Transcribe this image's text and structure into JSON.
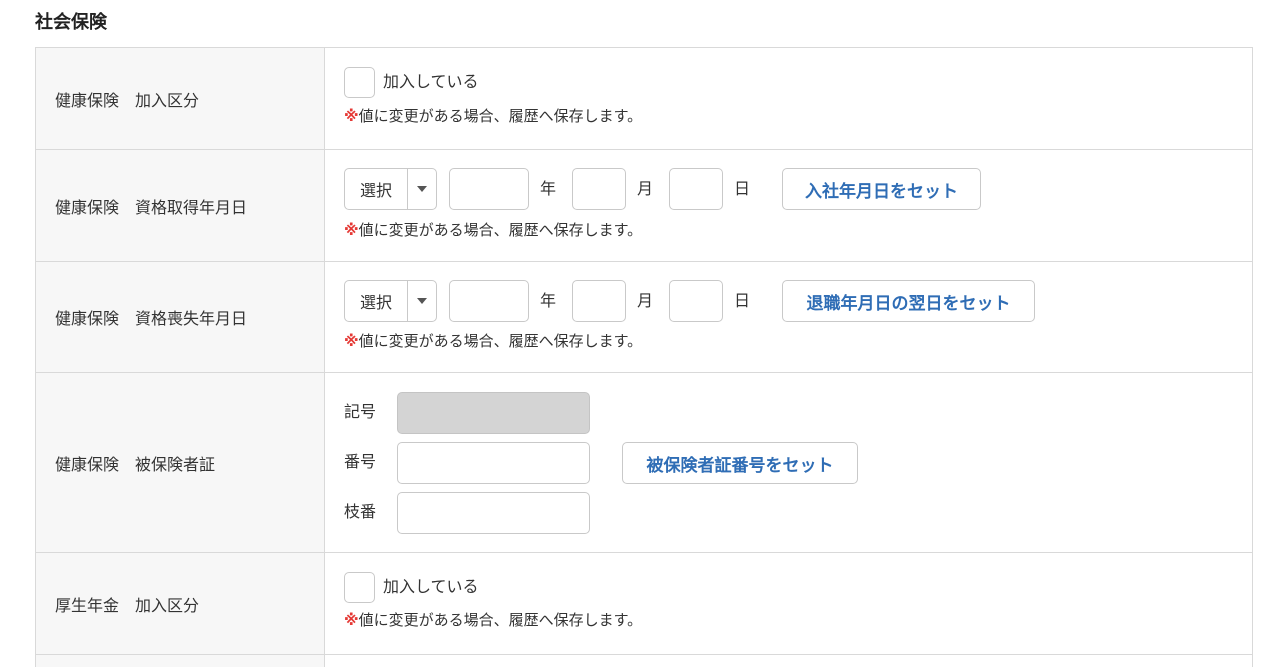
{
  "section": {
    "title": "社会保険"
  },
  "note_text": "値に変更がある場合、履歴へ保存します。",
  "note_mark": "※",
  "units": {
    "year": "年",
    "month": "月",
    "day": "日"
  },
  "rows": [
    {
      "label": "健康保険　加入区分",
      "checkbox_label": "加入している",
      "checked": false
    },
    {
      "label": "健康保険　資格取得年月日",
      "select_value": "選択",
      "year": "",
      "month": "",
      "day": "",
      "button": "入社年月日をセット"
    },
    {
      "label": "健康保険　資格喪失年月日",
      "select_value": "選択",
      "year": "",
      "month": "",
      "day": "",
      "button": "退職年月日の翌日をセット"
    },
    {
      "label": "健康保険　被保険者証",
      "symbol_label": "記号",
      "symbol_value": "",
      "number_label": "番号",
      "number_value": "",
      "branch_label": "枝番",
      "branch_value": "",
      "button": "被保険者証番号をセット"
    },
    {
      "label": "厚生年金　加入区分",
      "checkbox_label": "加入している",
      "checked": false
    }
  ]
}
